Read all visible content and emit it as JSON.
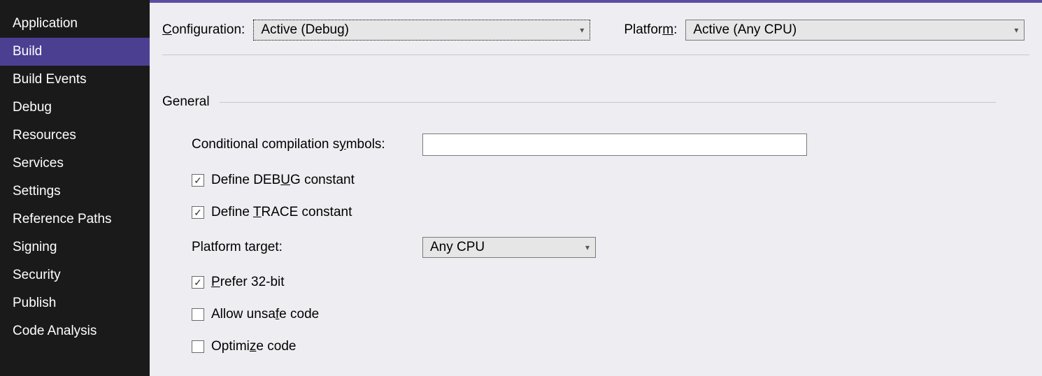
{
  "sidebar": {
    "items": [
      {
        "label": "Application"
      },
      {
        "label": "Build"
      },
      {
        "label": "Build Events"
      },
      {
        "label": "Debug"
      },
      {
        "label": "Resources"
      },
      {
        "label": "Services"
      },
      {
        "label": "Settings"
      },
      {
        "label": "Reference Paths"
      },
      {
        "label": "Signing"
      },
      {
        "label": "Security"
      },
      {
        "label": "Publish"
      },
      {
        "label": "Code Analysis"
      }
    ],
    "active_index": 1
  },
  "top": {
    "configuration_label_pre": "C",
    "configuration_label_post": "onfiguration:",
    "configuration_value": "Active (Debug)",
    "platform_label_pre": "Platfor",
    "platform_label_u": "m",
    "platform_label_post": ":",
    "platform_value": "Active (Any CPU)"
  },
  "section": {
    "general": "General"
  },
  "form": {
    "cond_sym_label_pre": "Conditional compilation s",
    "cond_sym_label_u": "y",
    "cond_sym_label_post": "mbols:",
    "cond_sym_value": "",
    "define_debug_pre": "Define DEB",
    "define_debug_u": "U",
    "define_debug_post": "G constant",
    "define_debug_checked": true,
    "define_trace_pre": "Define ",
    "define_trace_u": "T",
    "define_trace_post": "RACE constant",
    "define_trace_checked": true,
    "platform_target_label_pre": "Platform tar",
    "platform_target_label_u": "g",
    "platform_target_label_post": "et:",
    "platform_target_value": "Any CPU",
    "prefer32_u": "P",
    "prefer32_post": "refer 32-bit",
    "prefer32_checked": true,
    "unsafe_pre": "Allow unsa",
    "unsafe_u": "f",
    "unsafe_post": "e code",
    "unsafe_checked": false,
    "optimize_pre": "Optimi",
    "optimize_u": "z",
    "optimize_post": "e code",
    "optimize_checked": false
  }
}
